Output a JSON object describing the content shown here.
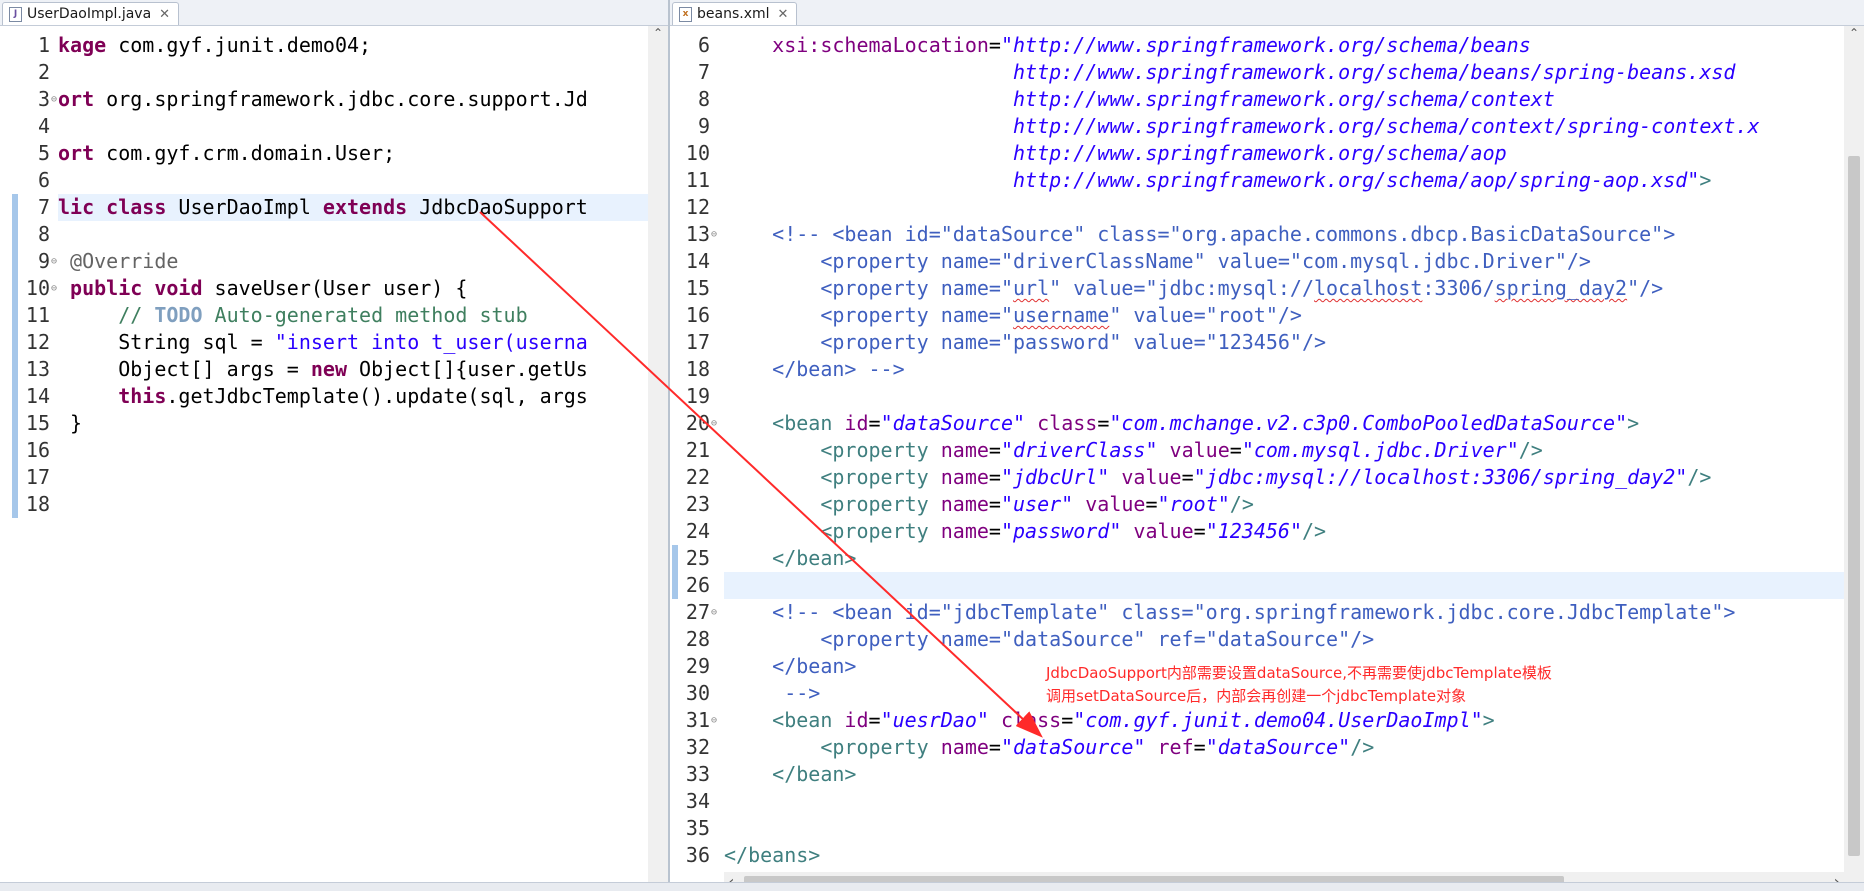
{
  "left_editor": {
    "tab_label": "UserDaoImpl.java",
    "line_numbers": [
      "1",
      "2",
      "3",
      "4",
      "5",
      "6",
      "7",
      "8",
      "9",
      "10",
      "11",
      "12",
      "13",
      "14",
      "15",
      "16",
      "17",
      "18"
    ],
    "lines": [
      [
        {
          "t": "kage ",
          "c": "kw"
        },
        {
          "t": "com.gyf.junit.demo04;",
          "c": "plain"
        }
      ],
      [],
      [
        {
          "t": "ort ",
          "c": "kw"
        },
        {
          "t": "org.springframework.jdbc.core.support.Jd",
          "c": "plain"
        }
      ],
      [],
      [
        {
          "t": "ort ",
          "c": "kw"
        },
        {
          "t": "com.gyf.crm.domain.User;",
          "c": "plain"
        }
      ],
      [],
      [
        {
          "t": "lic class ",
          "c": "kw"
        },
        {
          "t": "UserDaoImpl ",
          "c": "plain"
        },
        {
          "t": "extends ",
          "c": "kw"
        },
        {
          "t": "JdbcDaoSupport",
          "c": "plain"
        }
      ],
      [],
      [
        {
          "t": " @Override",
          "c": "ann"
        }
      ],
      [
        {
          "t": " ",
          "c": "plain"
        },
        {
          "t": "public void ",
          "c": "kw"
        },
        {
          "t": "saveUser(User user) {",
          "c": "plain"
        }
      ],
      [
        {
          "t": "     // ",
          "c": "cm"
        },
        {
          "t": "TODO",
          "c": "todo"
        },
        {
          "t": " Auto-generated method stub",
          "c": "cm"
        }
      ],
      [
        {
          "t": "     String sql = ",
          "c": "plain"
        },
        {
          "t": "\"insert into t_user(userna",
          "c": "str"
        }
      ],
      [
        {
          "t": "     Object[] args = ",
          "c": "plain"
        },
        {
          "t": "new ",
          "c": "kw"
        },
        {
          "t": "Object[]{user.getUs",
          "c": "plain"
        }
      ],
      [
        {
          "t": "     ",
          "c": "plain"
        },
        {
          "t": "this",
          "c": "kw"
        },
        {
          "t": ".getJdbcTemplate().update(sql, args",
          "c": "plain"
        }
      ],
      [
        {
          "t": " }",
          "c": "plain"
        }
      ],
      [],
      [],
      []
    ]
  },
  "right_editor": {
    "tab_label": "beans.xml",
    "line_numbers": [
      "6",
      "7",
      "8",
      "9",
      "10",
      "11",
      "12",
      "13",
      "14",
      "15",
      "16",
      "17",
      "18",
      "19",
      "20",
      "21",
      "22",
      "23",
      "24",
      "25",
      "26",
      "27",
      "28",
      "29",
      "30",
      "31",
      "32",
      "33",
      "34",
      "35",
      "36"
    ],
    "lines": [
      [
        {
          "t": "    xsi:schemaLocation",
          "c": "attr"
        },
        {
          "t": "=",
          "c": "plain"
        },
        {
          "t": "\"http://www.springframework.org/schema/beans",
          "c": "val"
        }
      ],
      [
        {
          "t": "                        http://www.springframework.org/schema/beans/spring-beans.xsd",
          "c": "val"
        }
      ],
      [
        {
          "t": "                        http://www.springframework.org/schema/context",
          "c": "val"
        }
      ],
      [
        {
          "t": "                        http://www.springframework.org/schema/context/spring-context.x",
          "c": "val"
        }
      ],
      [
        {
          "t": "                        http://www.springframework.org/schema/aop",
          "c": "val"
        }
      ],
      [
        {
          "t": "                        http://www.springframework.org/schema/aop/spring-aop.xsd\"",
          "c": "val"
        },
        {
          "t": ">",
          "c": "tag"
        }
      ],
      [],
      [
        {
          "t": "    <!-- <bean id=\"dataSource\" class=\"org.apache.commons.dbcp.BasicDataSource\">",
          "c": "xcm"
        }
      ],
      [
        {
          "t": "        <property name=\"driverClassName\" value=\"com.mysql.jdbc.Driver\"/>",
          "c": "xcm"
        }
      ],
      [
        {
          "t": "        <property name=\"",
          "c": "xcm"
        },
        {
          "t": "url",
          "c": "xcm squig"
        },
        {
          "t": "\" value=\"jdbc:mysql://",
          "c": "xcm"
        },
        {
          "t": "localhost",
          "c": "xcm squig"
        },
        {
          "t": ":3306/",
          "c": "xcm"
        },
        {
          "t": "spring_day2",
          "c": "xcm squig"
        },
        {
          "t": "\"/>",
          "c": "xcm"
        }
      ],
      [
        {
          "t": "        <property name=\"",
          "c": "xcm"
        },
        {
          "t": "username",
          "c": "xcm squig"
        },
        {
          "t": "\" value=\"root\"/>",
          "c": "xcm"
        }
      ],
      [
        {
          "t": "        <property name=\"password\" value=\"123456\"/>",
          "c": "xcm"
        }
      ],
      [
        {
          "t": "    </bean> -->",
          "c": "xcm"
        }
      ],
      [],
      [
        {
          "t": "    <bean ",
          "c": "tag"
        },
        {
          "t": "id",
          "c": "attr"
        },
        {
          "t": "=",
          "c": "plain"
        },
        {
          "t": "\"dataSource\" ",
          "c": "val"
        },
        {
          "t": "class",
          "c": "attr"
        },
        {
          "t": "=",
          "c": "plain"
        },
        {
          "t": "\"com.mchange.v2.c3p0.ComboPooledDataSource\"",
          "c": "val"
        },
        {
          "t": ">",
          "c": "tag"
        }
      ],
      [
        {
          "t": "        <property ",
          "c": "tag"
        },
        {
          "t": "name",
          "c": "attr"
        },
        {
          "t": "=",
          "c": "plain"
        },
        {
          "t": "\"driverClass\" ",
          "c": "val"
        },
        {
          "t": "value",
          "c": "attr"
        },
        {
          "t": "=",
          "c": "plain"
        },
        {
          "t": "\"com.mysql.jdbc.Driver\"",
          "c": "val"
        },
        {
          "t": "/>",
          "c": "tag"
        }
      ],
      [
        {
          "t": "        <property ",
          "c": "tag"
        },
        {
          "t": "name",
          "c": "attr"
        },
        {
          "t": "=",
          "c": "plain"
        },
        {
          "t": "\"jdbcUrl\" ",
          "c": "val"
        },
        {
          "t": "value",
          "c": "attr"
        },
        {
          "t": "=",
          "c": "plain"
        },
        {
          "t": "\"jdbc:mysql://localhost:3306/spring_day2\"",
          "c": "val"
        },
        {
          "t": "/>",
          "c": "tag"
        }
      ],
      [
        {
          "t": "        <property ",
          "c": "tag"
        },
        {
          "t": "name",
          "c": "attr"
        },
        {
          "t": "=",
          "c": "plain"
        },
        {
          "t": "\"user\" ",
          "c": "val"
        },
        {
          "t": "value",
          "c": "attr"
        },
        {
          "t": "=",
          "c": "plain"
        },
        {
          "t": "\"root\"",
          "c": "val"
        },
        {
          "t": "/>",
          "c": "tag"
        }
      ],
      [
        {
          "t": "        <property ",
          "c": "tag"
        },
        {
          "t": "name",
          "c": "attr"
        },
        {
          "t": "=",
          "c": "plain"
        },
        {
          "t": "\"password\" ",
          "c": "val"
        },
        {
          "t": "value",
          "c": "attr"
        },
        {
          "t": "=",
          "c": "plain"
        },
        {
          "t": "\"123456\"",
          "c": "val"
        },
        {
          "t": "/>",
          "c": "tag"
        }
      ],
      [
        {
          "t": "    </bean>",
          "c": "tag"
        }
      ],
      [],
      [
        {
          "t": "    <!-- <bean id=\"jdbcTemplate\" class=\"org.springframework.jdbc.core.JdbcTemplate\">",
          "c": "xcm"
        }
      ],
      [
        {
          "t": "        <property name=\"dataSource\" ref=\"dataSource\"/>",
          "c": "xcm"
        }
      ],
      [
        {
          "t": "    </bean>",
          "c": "xcm"
        }
      ],
      [
        {
          "t": "     -->",
          "c": "xcm"
        }
      ],
      [
        {
          "t": "    <bean ",
          "c": "tag"
        },
        {
          "t": "id",
          "c": "attr"
        },
        {
          "t": "=",
          "c": "plain"
        },
        {
          "t": "\"uesrDao\" ",
          "c": "val"
        },
        {
          "t": "class",
          "c": "attr"
        },
        {
          "t": "=",
          "c": "plain"
        },
        {
          "t": "\"com.gyf.junit.demo04.UserDaoImpl\"",
          "c": "val"
        },
        {
          "t": ">",
          "c": "tag"
        }
      ],
      [
        {
          "t": "        <property ",
          "c": "tag"
        },
        {
          "t": "name",
          "c": "attr"
        },
        {
          "t": "=",
          "c": "plain"
        },
        {
          "t": "\"dataSource\" ",
          "c": "val"
        },
        {
          "t": "ref",
          "c": "attr"
        },
        {
          "t": "=",
          "c": "plain"
        },
        {
          "t": "\"dataSource\"",
          "c": "val"
        },
        {
          "t": "/>",
          "c": "tag"
        }
      ],
      [
        {
          "t": "    </bean>",
          "c": "tag"
        }
      ],
      [],
      [],
      [
        {
          "t": "</beans>",
          "c": "tag"
        }
      ]
    ]
  },
  "annotation": {
    "line1": "JdbcDaoSupport内部需要设置dataSource,不再需要使jdbcTemplate模板",
    "line2": "调用setDataSource后，内部会再创建一个jdbcTemplate对象",
    "color": "#ff2a2a"
  }
}
